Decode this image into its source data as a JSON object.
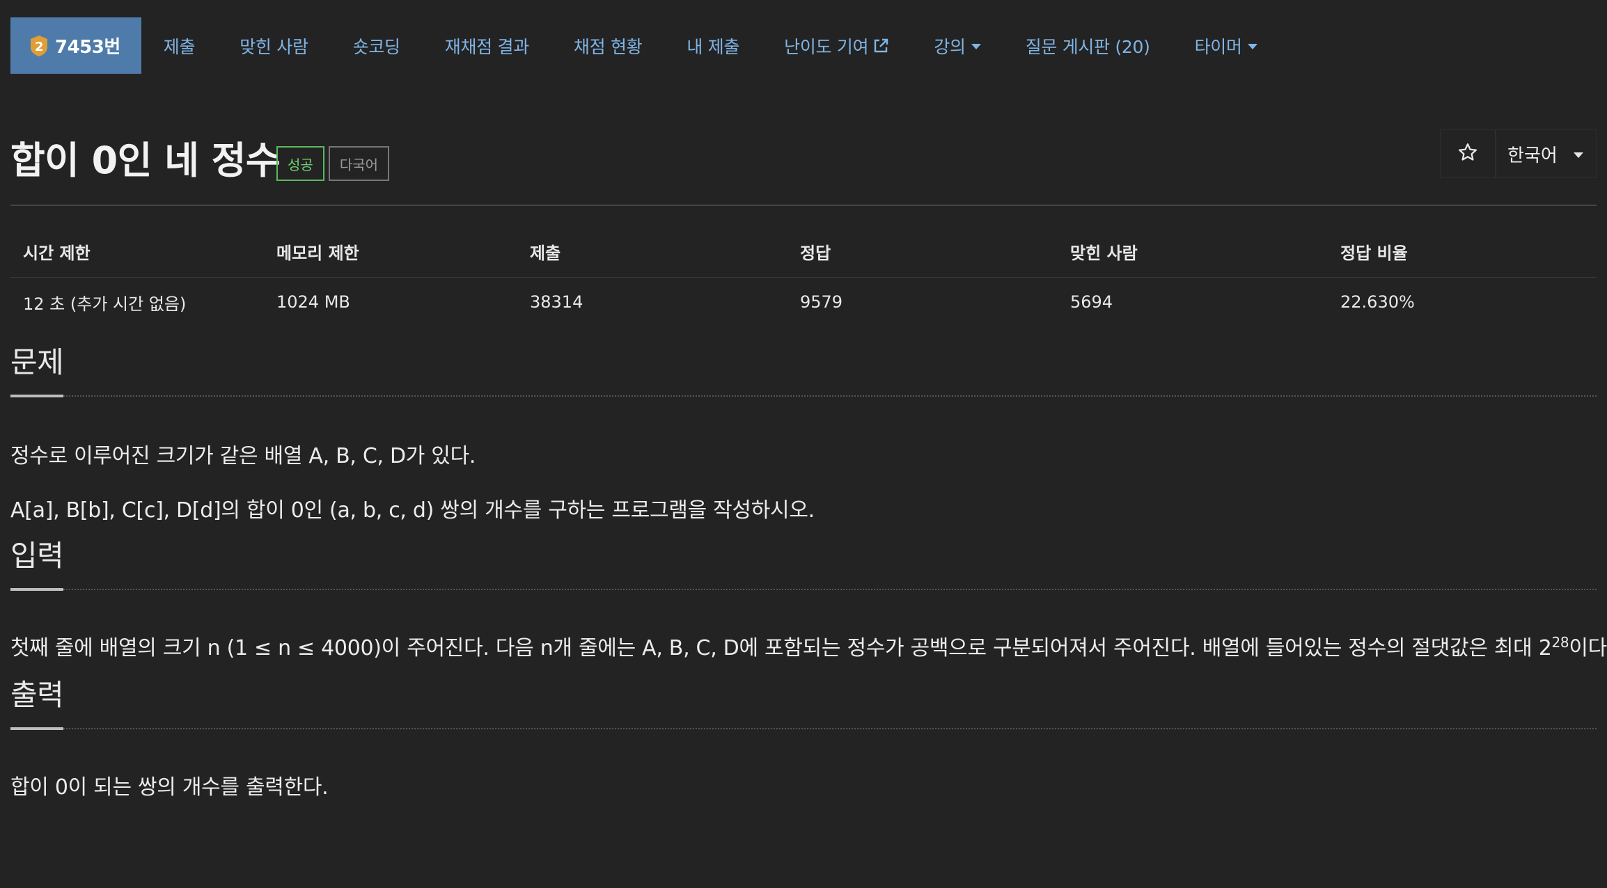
{
  "nav": {
    "problem_id": "7453번",
    "tier_number": "2",
    "items": [
      {
        "label": "제출"
      },
      {
        "label": "맞힌 사람"
      },
      {
        "label": "숏코딩"
      },
      {
        "label": "재채점 결과"
      },
      {
        "label": "채점 현황"
      },
      {
        "label": "내 제출"
      },
      {
        "label": "난이도 기여"
      },
      {
        "label": "강의"
      },
      {
        "label": "질문 게시판 (20)"
      },
      {
        "label": "타이머"
      }
    ]
  },
  "problem": {
    "title": "합이 0인 네 정수",
    "badges": {
      "success": "성공",
      "multilang": "다국어"
    }
  },
  "toolbar": {
    "star_icon": "☆",
    "language": "한국어"
  },
  "info": {
    "headers": [
      "시간 제한",
      "메모리 제한",
      "제출",
      "정답",
      "맞힌 사람",
      "정답 비율"
    ],
    "values": [
      "12 초 (추가 시간 없음)",
      "1024 MB",
      "38314",
      "9579",
      "5694",
      "22.630%"
    ]
  },
  "sections": {
    "description": {
      "heading": "문제",
      "lines": [
        "정수로 이루어진 크기가 같은 배열 A, B, C, D가 있다.",
        "A[a], B[b], C[c], D[d]의 합이 0인 (a, b, c, d) 쌍의 개수를 구하는 프로그램을 작성하시오."
      ]
    },
    "input": {
      "heading": "입력",
      "text_before": "첫째 줄에 배열의 크기 n (1 ≤ n ≤ 4000)이 주어진다. 다음 n개 줄에는 A, B, C, D에 포함되는 정수가 공백으로 구분되어져서 주어진다. 배열에 들어있는 정수의 절댓값은 최대 2",
      "superscript": "28",
      "text_after": "이다."
    },
    "output": {
      "heading": "출력",
      "text": "합이 0이 되는 쌍의 개수를 출력한다."
    }
  },
  "colors": {
    "background": "#232323",
    "nav_link": "#80b4e5",
    "problem_tab": "#4f7baa",
    "success": "#5cb85c"
  }
}
